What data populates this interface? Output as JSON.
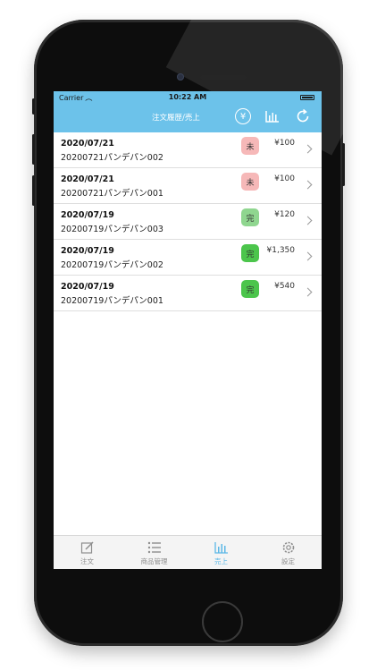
{
  "status_bar": {
    "carrier": "Carrier",
    "time": "10:22 AM"
  },
  "nav": {
    "title": "注文履歴/売上",
    "icons": [
      "yen-icon",
      "bar-chart-icon",
      "refresh-icon"
    ],
    "yen_glyph": "¥"
  },
  "colors": {
    "header": "#6cc2ea",
    "badge_pending": "#f6b8b8",
    "badge_done_light": "#8fd68f",
    "badge_done": "#4cc54c",
    "tab_active": "#5cb8e6"
  },
  "orders": [
    {
      "date": "2020/07/21",
      "name": "20200721パンデパン002",
      "status": "未",
      "amount": "¥100",
      "state": "pending"
    },
    {
      "date": "2020/07/21",
      "name": "20200721パンデパン001",
      "status": "未",
      "amount": "¥100",
      "state": "pending"
    },
    {
      "date": "2020/07/19",
      "name": "20200719パンデパン003",
      "status": "完",
      "amount": "¥120",
      "state": "done-light"
    },
    {
      "date": "2020/07/19",
      "name": "20200719パンデパン002",
      "status": "完",
      "amount": "¥1,350",
      "state": "done"
    },
    {
      "date": "2020/07/19",
      "name": "20200719パンデパン001",
      "status": "完",
      "amount": "¥540",
      "state": "done"
    }
  ],
  "tabs": [
    {
      "label": "注文",
      "icon": "edit-icon",
      "active": false
    },
    {
      "label": "商品管理",
      "icon": "list-icon",
      "active": false
    },
    {
      "label": "売上",
      "icon": "bar-chart-icon",
      "active": true
    },
    {
      "label": "設定",
      "icon": "gear-icon",
      "active": false
    }
  ]
}
